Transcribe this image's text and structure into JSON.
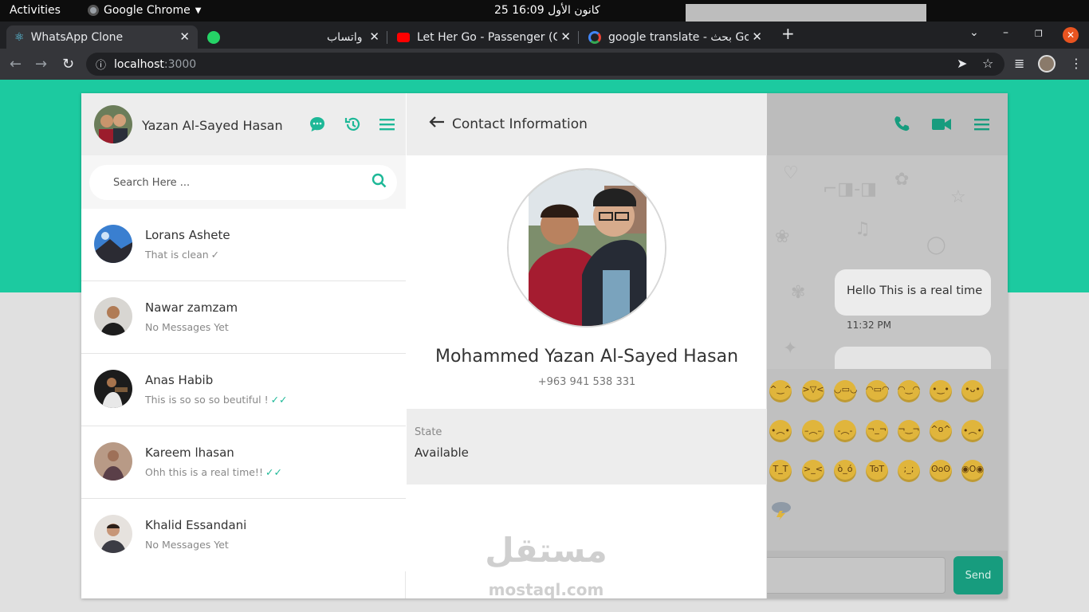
{
  "os": {
    "activities": "Activities",
    "app_name": "Google Chrome",
    "clock": "25 كانون الأول  16:09",
    "lang": "en"
  },
  "browser": {
    "tabs": [
      {
        "title": "WhatsApp Clone"
      },
      {
        "title": "واتساب"
      },
      {
        "title": "Let Her Go - Passenger (O"
      },
      {
        "title": "google translate - بحث Go"
      }
    ],
    "url_host": "localhost",
    "url_port": ":3000"
  },
  "sidebar": {
    "user_name": "Yazan Al-Sayed Hasan",
    "search_placeholder": "Search Here ...",
    "chats": [
      {
        "name": "Lorans Ashete",
        "last": "That is clean",
        "tick": "✓",
        "read": false
      },
      {
        "name": "Nawar zamzam",
        "last": "No Messages Yet",
        "tick": "",
        "read": false
      },
      {
        "name": "Anas Habib",
        "last": "This is so so so beutiful !",
        "tick": "✓✓",
        "read": true
      },
      {
        "name": "Kareem lhasan",
        "last": "Ohh this is a real time!!",
        "tick": "✓✓",
        "read": true
      },
      {
        "name": "Khalid Essandani",
        "last": "No Messages Yet",
        "tick": "",
        "read": false
      }
    ]
  },
  "contact": {
    "title": "Contact Information",
    "full_name": "Mohammed Yazan Al-Sayed Hasan",
    "phone": "+963 941 538 331",
    "state_label": "State",
    "state_value": "Available"
  },
  "conversation": {
    "message": "Hello This is a real time",
    "time": "11:32 PM",
    "send_label": "Send"
  },
  "watermark": {
    "text_ar": "مستقل",
    "text_en": "mostaql.com"
  },
  "colors": {
    "brand": "#1ccaa0",
    "icon": "#1db897",
    "send": "#179c7e"
  }
}
